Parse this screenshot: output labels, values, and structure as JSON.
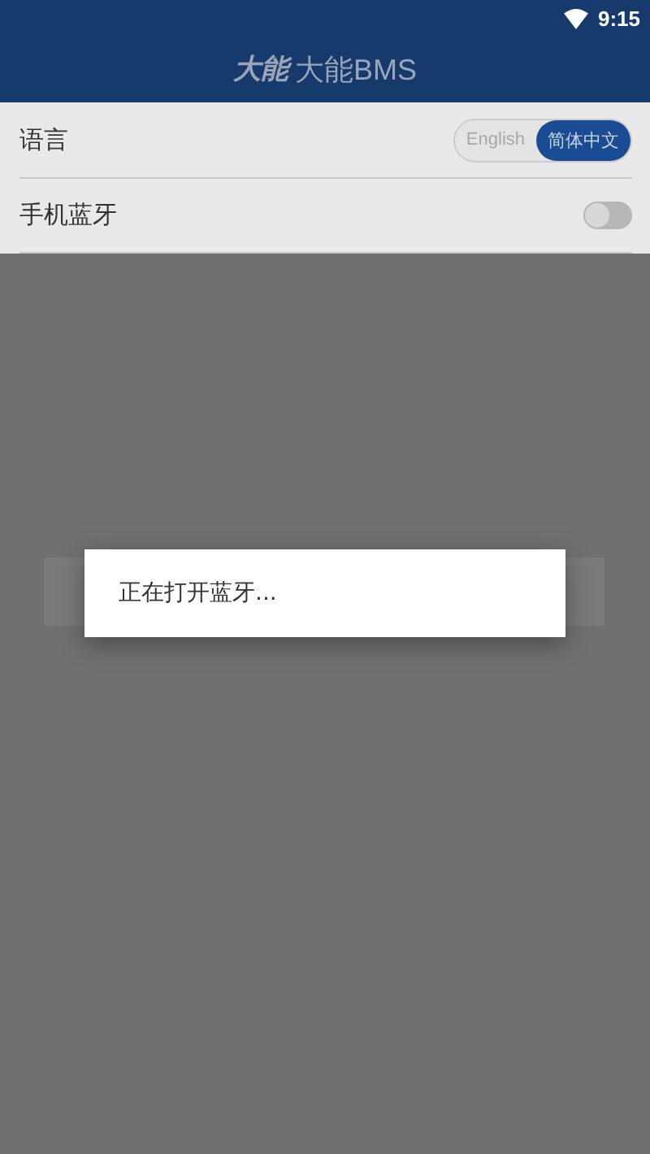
{
  "status_bar": {
    "time": "9:15"
  },
  "header": {
    "logo": "大能",
    "title": "大能BMS"
  },
  "settings": [
    {
      "kind": "segmented",
      "label": "语言",
      "options": [
        {
          "label": "English",
          "selected": false
        },
        {
          "label": "简体中文",
          "selected": true
        }
      ]
    },
    {
      "kind": "switch",
      "label": "手机蓝牙",
      "on": false
    }
  ],
  "dialog": {
    "message": "正在打开蓝牙..."
  }
}
